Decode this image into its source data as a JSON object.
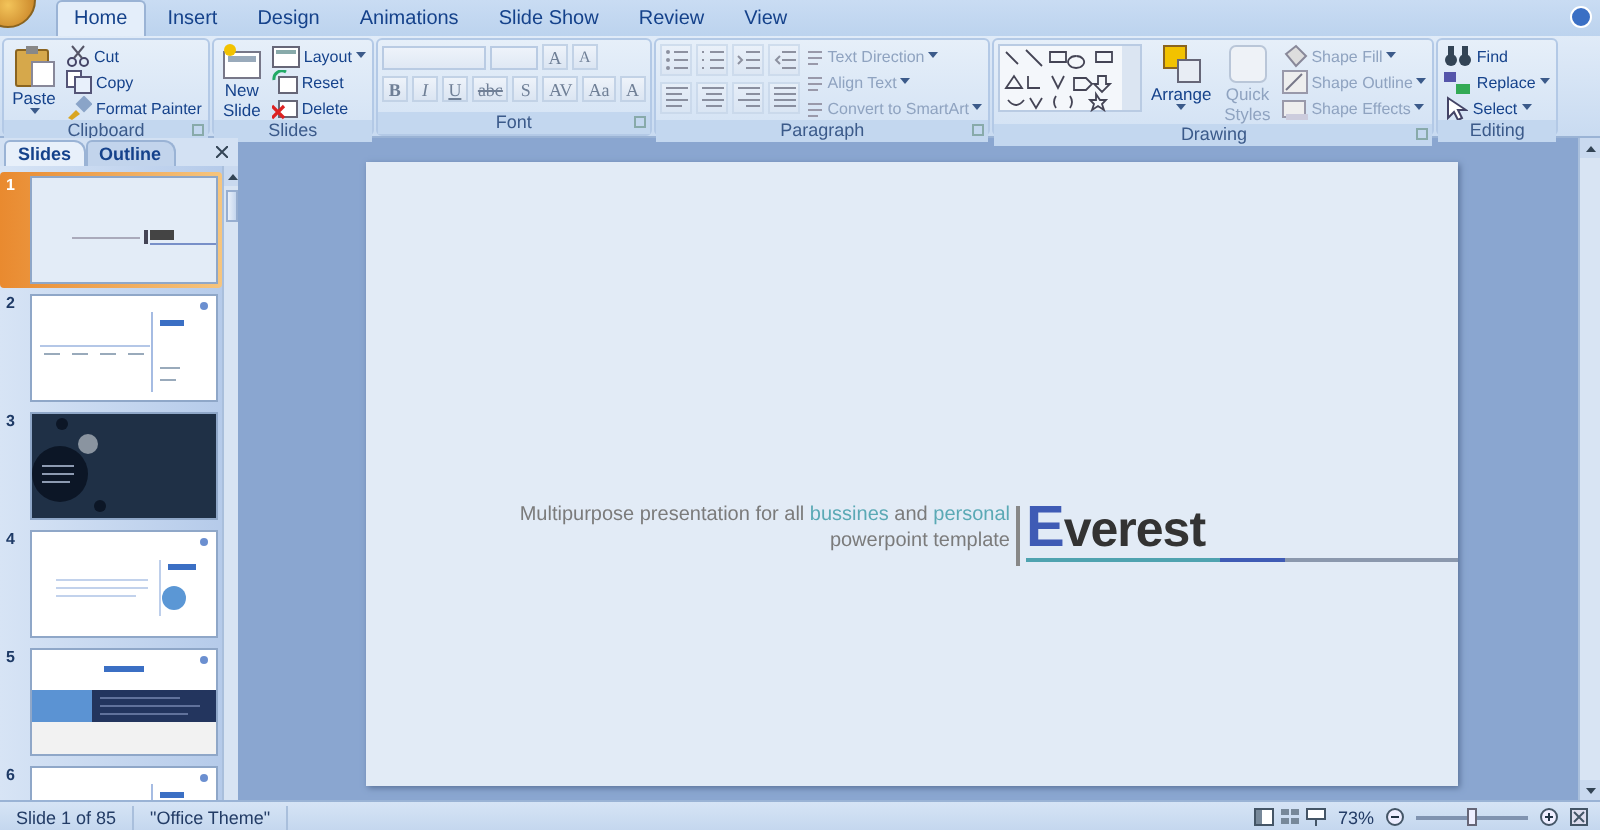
{
  "tabs": [
    {
      "label": "Home",
      "selected": true
    },
    {
      "label": "Insert",
      "selected": false
    },
    {
      "label": "Design",
      "selected": false
    },
    {
      "label": "Animations",
      "selected": false
    },
    {
      "label": "Slide Show",
      "selected": false
    },
    {
      "label": "Review",
      "selected": false
    },
    {
      "label": "View",
      "selected": false
    }
  ],
  "clipboard": {
    "label": "Clipboard",
    "paste": "Paste",
    "items": [
      {
        "label": "Cut"
      },
      {
        "label": "Copy"
      },
      {
        "label": "Format Painter"
      }
    ]
  },
  "slides_group": {
    "label": "Slides",
    "new_slide": "New Slide",
    "items": [
      {
        "label": "Layout",
        "dropdown": true
      },
      {
        "label": "Reset",
        "dropdown": false
      },
      {
        "label": "Delete",
        "dropdown": false
      }
    ]
  },
  "font": {
    "label": "Font",
    "disabled": true,
    "size_buttons": [
      "A",
      "A"
    ],
    "buttons": [
      "B",
      "I",
      "U",
      "abc",
      "S",
      "AV",
      "Aa",
      "A"
    ]
  },
  "paragraph": {
    "label": "Paragraph",
    "items": [
      {
        "label": "Text Direction",
        "disabled": true
      },
      {
        "label": "Align Text",
        "disabled": true
      },
      {
        "label": "Convert to SmartArt",
        "disabled": true
      }
    ]
  },
  "drawing": {
    "label": "Drawing",
    "arrange": "Arrange",
    "quick_styles": {
      "label": "Quick Styles",
      "disabled": true
    },
    "items": [
      {
        "label": "Shape Fill",
        "disabled": true
      },
      {
        "label": "Shape Outline",
        "disabled": true
      },
      {
        "label": "Shape Effects",
        "disabled": true
      }
    ]
  },
  "editing": {
    "label": "Editing",
    "items": [
      {
        "label": "Find",
        "dropdown": false
      },
      {
        "label": "Replace",
        "dropdown": true
      },
      {
        "label": "Select",
        "dropdown": true
      }
    ]
  },
  "slide_pane": {
    "tabs": [
      {
        "label": "Slides",
        "selected": true
      },
      {
        "label": "Outline",
        "selected": false
      }
    ],
    "thumbnails": [
      {
        "number": "1",
        "selected": true,
        "kind": "title"
      },
      {
        "number": "2",
        "selected": false,
        "kind": "agenda"
      },
      {
        "number": "3",
        "selected": false,
        "kind": "dark"
      },
      {
        "number": "4",
        "selected": false,
        "kind": "circle"
      },
      {
        "number": "5",
        "selected": false,
        "kind": "banner"
      },
      {
        "number": "6",
        "selected": false,
        "kind": "agenda"
      }
    ]
  },
  "slide": {
    "subtitle": [
      {
        "text": "Multipurpose presentation for all ",
        "highlight": false
      },
      {
        "text": "bussines",
        "highlight": true
      },
      {
        "text": " and ",
        "highlight": false
      },
      {
        "text": "personal",
        "highlight": true
      }
    ],
    "subtitle_line2": "powerpoint template",
    "title": "Everest"
  },
  "status_bar": {
    "slide": "Slide 1 of 85",
    "theme": "\"Office Theme\"",
    "zoom": "73%",
    "zoom_slider": {
      "level": 0.5
    }
  }
}
